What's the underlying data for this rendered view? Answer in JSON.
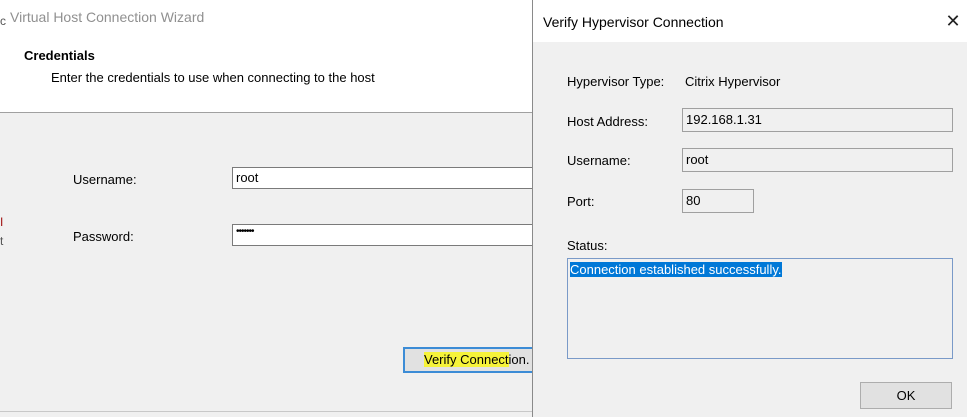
{
  "wizard": {
    "title": "Virtual Host Connection Wizard",
    "header_title": "Credentials",
    "header_description": "Enter the credentials to use when connecting to the host",
    "username_label": "Username:",
    "username_value": "root",
    "password_label": "Password:",
    "password_value": "•••••••",
    "verify_button_highlight": "Verify Connect",
    "verify_button_rest": "ion.",
    "edge_marks": [
      "c",
      "I",
      "t"
    ]
  },
  "dialog": {
    "title": "Verify Hypervisor Connection",
    "close_glyph": "✕",
    "hypervisor_type_label": "Hypervisor Type:",
    "hypervisor_type_value": "Citrix Hypervisor",
    "host_address_label": "Host Address:",
    "host_address_value": "192.168.1.31",
    "username_label": "Username:",
    "username_value": "root",
    "port_label": "Port:",
    "port_value": "80",
    "status_label": "Status:",
    "status_value": "Connection established successfully.",
    "ok_label": "OK"
  },
  "colors": {
    "highlight": "#f6f33a",
    "selection": "#0078d7",
    "focus_border": "#3c8cd6"
  }
}
